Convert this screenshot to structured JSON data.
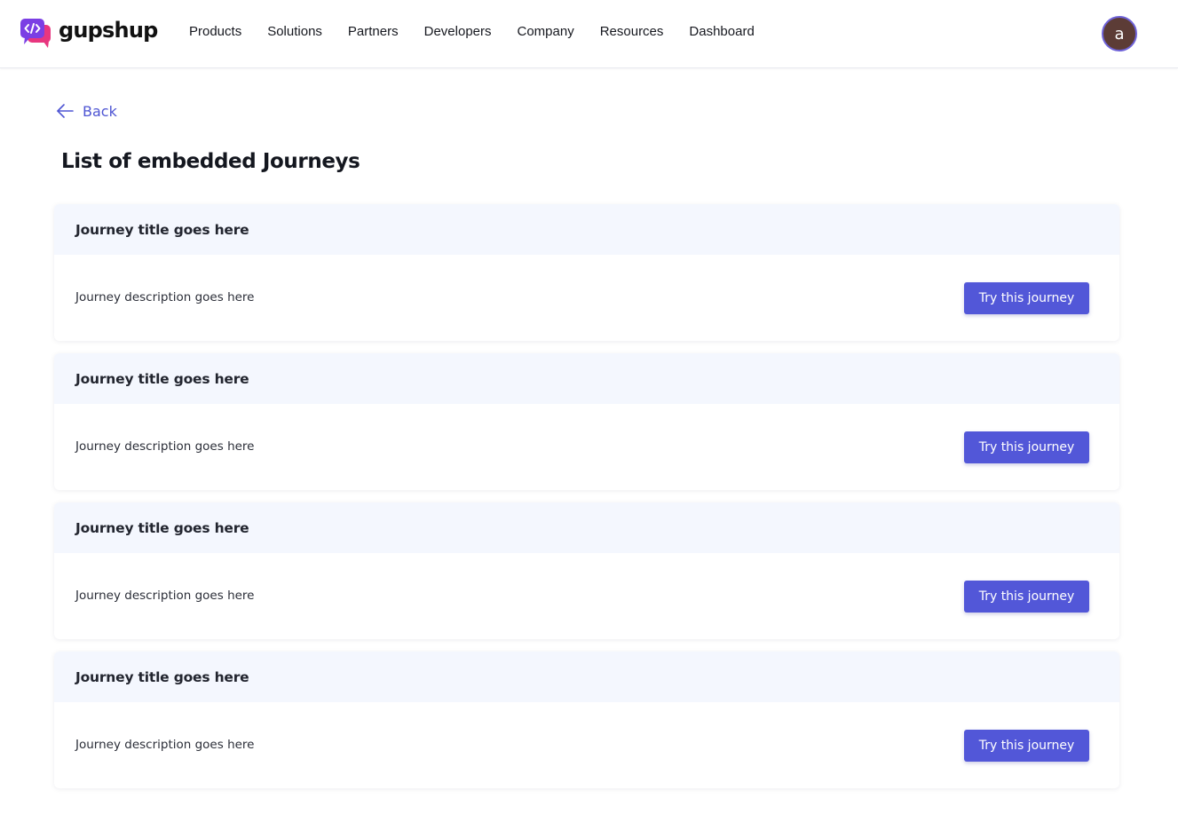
{
  "brand": {
    "name": "gupshup",
    "logo_icon": "code-chat-bubble-icon",
    "colors": {
      "primary": "#5257d8",
      "logo_purple": "#7b3fe4",
      "logo_pink": "#e8367f"
    }
  },
  "nav": {
    "items": [
      {
        "label": "Products"
      },
      {
        "label": "Solutions"
      },
      {
        "label": "Partners"
      },
      {
        "label": "Developers"
      },
      {
        "label": "Company"
      },
      {
        "label": "Resources"
      },
      {
        "label": "Dashboard"
      }
    ]
  },
  "user": {
    "avatar_initial": "a"
  },
  "back": {
    "label": "Back",
    "icon": "arrow-left-icon"
  },
  "page": {
    "title": "List of embedded Journeys"
  },
  "journeys": [
    {
      "title": "Journey title goes here",
      "description": "Journey description goes here",
      "button_label": "Try this journey"
    },
    {
      "title": "Journey title goes here",
      "description": "Journey description goes here",
      "button_label": "Try this journey"
    },
    {
      "title": "Journey title goes here",
      "description": "Journey description goes here",
      "button_label": "Try this journey"
    },
    {
      "title": "Journey title goes here",
      "description": "Journey description goes here",
      "button_label": "Try this journey"
    }
  ]
}
